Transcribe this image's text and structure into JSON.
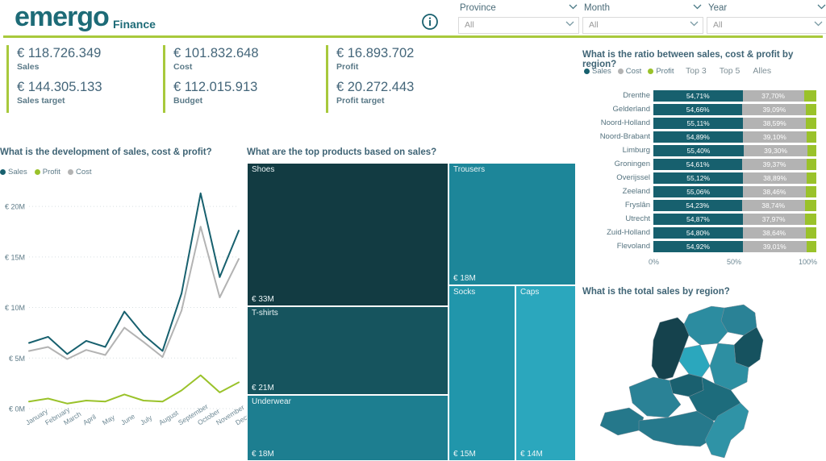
{
  "header": {
    "logo": "emergo",
    "subtitle": "Finance",
    "info_icon": "info-circle-icon",
    "filters": [
      {
        "label": "Province",
        "value": "All",
        "icon": "chevron-down-icon"
      },
      {
        "label": "Month",
        "value": "All",
        "icon": "chevron-down-icon"
      },
      {
        "label": "Year",
        "value": "All",
        "icon": "chevron-down-icon"
      }
    ]
  },
  "kpis": [
    {
      "value": "€ 118.726.349",
      "label": "Sales",
      "value2": "€ 144.305.133",
      "label2": "Sales target"
    },
    {
      "value": "€ 101.832.648",
      "label": "Cost",
      "value2": "€ 112.015.913",
      "label2": "Budget"
    },
    {
      "value": "€ 16.893.702",
      "label": "Profit",
      "value2": "€ 20.272.443",
      "label2": "Profit target"
    }
  ],
  "colors": {
    "sales": "#17606e",
    "cost": "#b3b3b3",
    "profit": "#9ac22a",
    "accent_green": "#a8c93c",
    "title": "#3f6475",
    "treemap_darkest": "#123b42",
    "treemap_lightest": "#2ba7bd"
  },
  "line_panel": {
    "title": "What is the development of sales, cost & profit?",
    "legend": [
      "Sales",
      "Profit",
      "Cost"
    ]
  },
  "treemap_panel": {
    "title": "What are the top products based on sales?"
  },
  "ratio_panel": {
    "title": "What is the ratio between sales, cost & profit by region?",
    "legend": [
      "Sales",
      "Cost",
      "Profit"
    ],
    "buttons": [
      "Top 3",
      "Top 5",
      "Alles"
    ]
  },
  "map_panel": {
    "title": "What is the total sales by region?"
  },
  "chart_data": [
    {
      "type": "line",
      "title": "What is the development of sales, cost & profit?",
      "xlabel": "",
      "ylabel": "",
      "ylim": [
        0,
        22
      ],
      "yticks": [
        0,
        5,
        10,
        15,
        20
      ],
      "ytick_labels": [
        "€ 0M",
        "€ 5M",
        "€ 10M",
        "€ 15M",
        "€ 20M"
      ],
      "grid": true,
      "legend_position": "top-left",
      "categories": [
        "January",
        "February",
        "March",
        "April",
        "May",
        "June",
        "July",
        "August",
        "September",
        "October",
        "November",
        "December"
      ],
      "series": [
        {
          "name": "Sales",
          "color": "#17606e",
          "values": [
            6.5,
            7.1,
            5.4,
            6.7,
            6.1,
            9.6,
            7.3,
            5.7,
            11.4,
            21.3,
            13.0,
            17.6
          ]
        },
        {
          "name": "Cost",
          "color": "#b3b3b3",
          "values": [
            5.7,
            6.1,
            4.9,
            5.8,
            5.3,
            8.0,
            6.6,
            5.1,
            9.7,
            18.0,
            11.0,
            14.8
          ]
        },
        {
          "name": "Profit",
          "color": "#9ac22a",
          "values": [
            0.7,
            1.0,
            0.5,
            0.8,
            0.7,
            1.4,
            0.8,
            0.7,
            1.8,
            3.3,
            1.6,
            2.6
          ]
        }
      ]
    },
    {
      "type": "treemap",
      "title": "What are the top products based on sales?",
      "labels": [
        "Shoes",
        "T-shirts",
        "Underwear",
        "Trousers",
        "Socks",
        "Caps"
      ],
      "value_labels": [
        "€ 33M",
        "€ 21M",
        "€ 18M",
        "€ 18M",
        "€ 15M",
        "€ 14M"
      ],
      "values": [
        33,
        21,
        18,
        18,
        15,
        14
      ]
    },
    {
      "type": "bar",
      "subtype": "stacked-horizontal-100",
      "title": "What is the ratio between sales, cost & profit by region?",
      "xlim": [
        0,
        100
      ],
      "xticks": [
        0,
        50,
        100
      ],
      "xtick_labels": [
        "0%",
        "50%",
        "100%"
      ],
      "categories": [
        "Drenthe",
        "Gelderland",
        "Noord-Holland",
        "Noord-Brabant",
        "Limburg",
        "Groningen",
        "Overijssel",
        "Zeeland",
        "Fryslân",
        "Utrecht",
        "Zuid-Holland",
        "Flevoland"
      ],
      "series": [
        {
          "name": "Sales",
          "color": "#17606e",
          "values": [
            54.71,
            54.66,
            55.11,
            54.89,
            55.4,
            54.61,
            55.12,
            55.06,
            54.23,
            54.87,
            54.8,
            54.92
          ],
          "labels": [
            "54,71%",
            "54,66%",
            "55,11%",
            "54,89%",
            "55,40%",
            "54,61%",
            "55,12%",
            "55,06%",
            "54,23%",
            "54,87%",
            "54,80%",
            "54,92%"
          ]
        },
        {
          "name": "Cost",
          "color": "#b3b3b3",
          "values": [
            37.7,
            39.09,
            38.59,
            39.1,
            39.3,
            39.37,
            38.89,
            38.46,
            38.74,
            37.97,
            38.64,
            39.01
          ],
          "labels": [
            "37,70%",
            "39,09%",
            "38,59%",
            "39,10%",
            "39,30%",
            "39,37%",
            "38,89%",
            "38,46%",
            "38,74%",
            "37,97%",
            "38,64%",
            "39,01%"
          ]
        },
        {
          "name": "Profit",
          "color": "#9ac22a",
          "values": [
            7.59,
            6.25,
            6.3,
            6.01,
            5.3,
            6.02,
            5.99,
            6.48,
            7.03,
            7.16,
            6.56,
            6.07
          ],
          "labels": [
            "",
            "",
            "",
            "",
            "",
            "",
            "",
            "",
            "",
            "",
            "",
            ""
          ]
        }
      ]
    },
    {
      "type": "map",
      "subtype": "choropleth",
      "title": "What is the total sales by region?",
      "region": "Netherlands",
      "regions": [
        {
          "name": "Groningen",
          "color": "#2a8296"
        },
        {
          "name": "Fryslân",
          "color": "#2c8ca0"
        },
        {
          "name": "Drenthe",
          "color": "#16525f"
        },
        {
          "name": "Overijssel",
          "color": "#2d8fa2"
        },
        {
          "name": "Flevoland",
          "color": "#2ba7bd"
        },
        {
          "name": "Gelderland",
          "color": "#1d6c7c"
        },
        {
          "name": "Utrecht",
          "color": "#1a606f"
        },
        {
          "name": "Noord-Holland",
          "color": "#15424d"
        },
        {
          "name": "Zuid-Holland",
          "color": "#2a8296"
        },
        {
          "name": "Zeeland",
          "color": "#25788b"
        },
        {
          "name": "Noord-Brabant",
          "color": "#26798c"
        },
        {
          "name": "Limburg",
          "color": "#2f93a6"
        }
      ]
    }
  ]
}
